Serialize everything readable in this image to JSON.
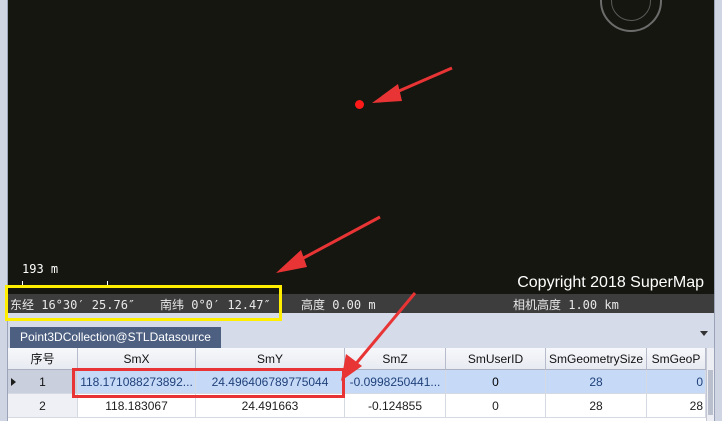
{
  "scene": {
    "scale_label": "193 m",
    "copyright": "Copyright 2018 SuperMap",
    "status": {
      "longitude": "东经 16°30′ 25.76″",
      "latitude": "南纬 0°0′ 12.47″",
      "altitude": "高度 0.00 m",
      "camera_altitude": "相机高度 1.00 km"
    }
  },
  "tab": {
    "label": "Point3DCollection@STLDatasource"
  },
  "table": {
    "columns": [
      "序号",
      "SmX",
      "SmY",
      "SmZ",
      "SmUserID",
      "SmGeometrySize",
      "SmGeoP"
    ],
    "rows": [
      [
        "1",
        "118.171088273892...",
        "24.496406789775044",
        "-0.0998250441...",
        "0",
        "28",
        "0"
      ],
      [
        "2",
        "118.183067",
        "24.491663",
        "-0.124855",
        "0",
        "28",
        "28"
      ]
    ]
  },
  "colors": {
    "scene_background": "#15160f",
    "point": "#ff1a1a",
    "tab_active": "#4d6082",
    "selected_row": "#c6daf8",
    "annotation_yellow": "#ffee00",
    "annotation_red": "#e83434"
  },
  "icons": [
    "compass-icon",
    "row-indicator-icon",
    "tab-menu-chevron-icon"
  ]
}
